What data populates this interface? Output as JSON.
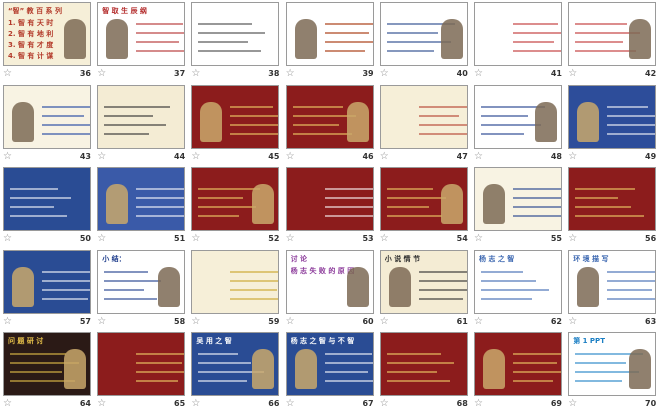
{
  "slides": [
    {
      "number": "36",
      "bg": "#f6efd8",
      "accent": "#b33a2a",
      "title": "“智” 教 百 系 列",
      "lines": [
        "1. 智 有 天 时",
        "2. 智 有 地 利",
        "3. 智 有 才 度",
        "4. 智 有 计 谋"
      ]
    },
    {
      "number": "37",
      "bg": "#ffffff",
      "accent": "#b32b2b",
      "title": "智 取 生 辰 纲",
      "lines": []
    },
    {
      "number": "38",
      "bg": "#ffffff",
      "accent": "#444444",
      "title": "",
      "lines": []
    },
    {
      "number": "39",
      "bg": "#ffffff",
      "accent": "#a22b00",
      "title": "",
      "lines": []
    },
    {
      "number": "40",
      "bg": "#ffffff",
      "accent": "#224488",
      "title": "",
      "lines": []
    },
    {
      "number": "41",
      "bg": "#ffffff",
      "accent": "#c03030",
      "title": "",
      "lines": []
    },
    {
      "number": "42",
      "bg": "#ffffff",
      "accent": "#c03030",
      "title": "",
      "lines": []
    },
    {
      "number": "43",
      "bg": "#f8f3e3",
      "accent": "#1a3fa0",
      "title": "",
      "lines": []
    },
    {
      "number": "44",
      "bg": "#f4ecd4",
      "accent": "#2a2a2a",
      "title": "",
      "lines": []
    },
    {
      "number": "45",
      "bg": "#8c1c1c",
      "accent": "#f3d36a",
      "title": "",
      "lines": []
    },
    {
      "number": "46",
      "bg": "#8c1c1c",
      "accent": "#f3d36a",
      "title": "",
      "lines": []
    },
    {
      "number": "47",
      "bg": "#f6efd8",
      "accent": "#b33a2a",
      "title": "",
      "lines": []
    },
    {
      "number": "48",
      "bg": "#ffffff",
      "accent": "#1b3a8a",
      "title": "",
      "lines": []
    },
    {
      "number": "49",
      "bg": "#2d4d9a",
      "accent": "#ffffff",
      "title": "",
      "lines": []
    },
    {
      "number": "50",
      "bg": "#2a4c94",
      "accent": "#ffffff",
      "title": "",
      "lines": []
    },
    {
      "number": "51",
      "bg": "#3a5aa8",
      "accent": "#ffffff",
      "title": "",
      "lines": []
    },
    {
      "number": "52",
      "bg": "#8c1c1c",
      "accent": "#f3d36a",
      "title": "",
      "lines": []
    },
    {
      "number": "53",
      "bg": "#8c1c1c",
      "accent": "#ffffff",
      "title": "",
      "lines": []
    },
    {
      "number": "54",
      "bg": "#8c1c1c",
      "accent": "#f3d36a",
      "title": "",
      "lines": []
    },
    {
      "number": "55",
      "bg": "#f8f3e3",
      "accent": "#1b3a8a",
      "title": "",
      "lines": []
    },
    {
      "number": "56",
      "bg": "#8c1c1c",
      "accent": "#f3d36a",
      "title": "",
      "lines": []
    },
    {
      "number": "57",
      "bg": "#2a4c94",
      "accent": "#ffffff",
      "title": "",
      "lines": []
    },
    {
      "number": "58",
      "bg": "#ffffff",
      "accent": "#1b3a8a",
      "title": "小 结：",
      "lines": []
    },
    {
      "number": "59",
      "bg": "#f6efd8",
      "accent": "#c9a227",
      "title": "",
      "lines": []
    },
    {
      "number": "60",
      "bg": "#ffffff",
      "accent": "#8b3a9a",
      "title": "讨 论",
      "lines": [
        "杨 志 失 败 的 原 因"
      ]
    },
    {
      "number": "61",
      "bg": "#f4ecd4",
      "accent": "#2a2a2a",
      "title": "小 说 情 节",
      "lines": []
    },
    {
      "number": "62",
      "bg": "#ffffff",
      "accent": "#3a66b0",
      "title": "杨 志 之 智",
      "lines": []
    },
    {
      "number": "63",
      "bg": "#ffffff",
      "accent": "#3a66b0",
      "title": "环 境 描 写",
      "lines": []
    },
    {
      "number": "64",
      "bg": "#2b1a16",
      "accent": "#e8c24a",
      "title": "问 题 研 讨",
      "lines": []
    },
    {
      "number": "65",
      "bg": "#8c1c1c",
      "accent": "#f3d36a",
      "title": "",
      "lines": []
    },
    {
      "number": "66",
      "bg": "#2a4c94",
      "accent": "#ffffff",
      "title": "吴 用 之 智",
      "lines": []
    },
    {
      "number": "67",
      "bg": "#2a4c94",
      "accent": "#ffffff",
      "title": "杨 志 之 智 与 不 智",
      "lines": []
    },
    {
      "number": "68",
      "bg": "#8c1c1c",
      "accent": "#f3d36a",
      "title": "",
      "lines": []
    },
    {
      "number": "69",
      "bg": "#8c1c1c",
      "accent": "#f3d36a",
      "title": "",
      "lines": []
    },
    {
      "number": "70",
      "bg": "#ffffff",
      "accent": "#1b7fc4",
      "title": "第 1 PPT",
      "lines": []
    }
  ],
  "icons": {
    "favorite": "star-icon"
  },
  "star_glyph": "☆"
}
